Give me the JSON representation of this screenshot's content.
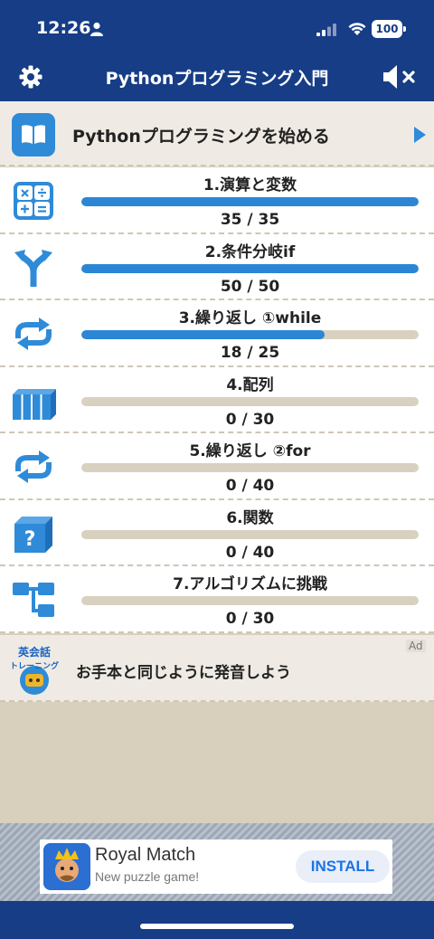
{
  "status_bar": {
    "time": "12:26",
    "battery": "100"
  },
  "header": {
    "title": "Pythonプログラミング入門"
  },
  "start": {
    "label": "Pythonプログラミングを始める"
  },
  "lessons": [
    {
      "title": "1.演算と変数",
      "progress": "35 / 35",
      "done": 35,
      "total": 35,
      "icon": "calculator-icon"
    },
    {
      "title": "2.条件分岐if",
      "progress": "50 / 50",
      "done": 50,
      "total": 50,
      "icon": "branch-arrow-icon"
    },
    {
      "title": "3.繰り返し ①while",
      "progress": "18 / 25",
      "done": 18,
      "total": 25,
      "icon": "loop-icon"
    },
    {
      "title": "4.配列",
      "progress": "0 / 30",
      "done": 0,
      "total": 30,
      "icon": "array-boxes-icon"
    },
    {
      "title": "5.繰り返し ②for",
      "progress": "0 / 40",
      "done": 0,
      "total": 40,
      "icon": "loop-icon"
    },
    {
      "title": "6.関数",
      "progress": "0 / 40",
      "done": 0,
      "total": 40,
      "icon": "function-box-icon"
    },
    {
      "title": "7.アルゴリズムに挑戦",
      "progress": "0 / 30",
      "done": 0,
      "total": 30,
      "icon": "flowchart-icon"
    }
  ],
  "promo": {
    "logo_text_top": "英会話",
    "logo_text_bottom": "トレーニング",
    "text": "お手本と同じように発音しよう",
    "ad_tag": "Ad"
  },
  "ad_banner": {
    "app_name": "Royal Match",
    "subtitle": "New puzzle game!",
    "install_label": "INSTALL"
  },
  "colors": {
    "header": "#163d86",
    "accent": "#2c86d6",
    "track": "#d9d1c0",
    "background": "#d8d0bc"
  }
}
